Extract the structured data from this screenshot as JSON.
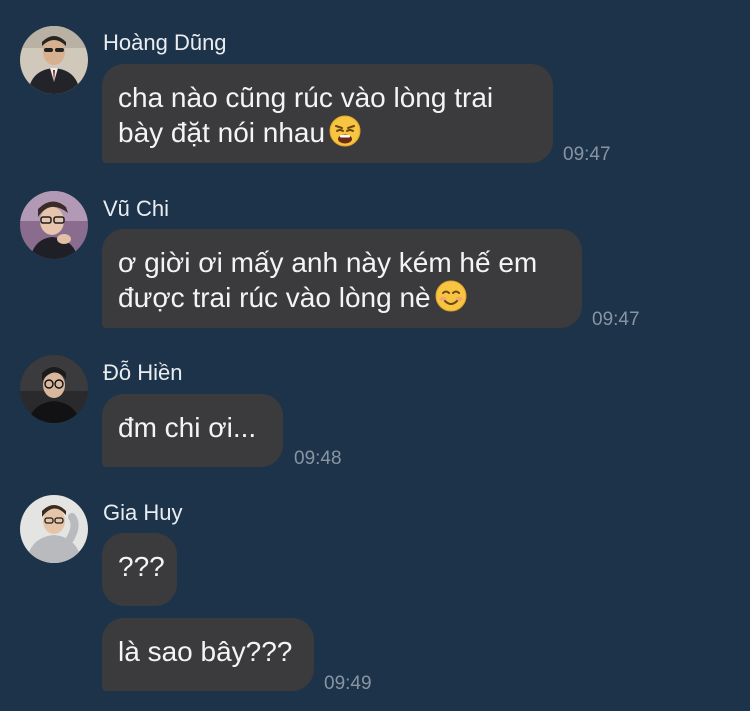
{
  "messages": [
    {
      "sender": "Hoàng Dũng",
      "avatar_icon": "profile-photo-man-suit",
      "line1": "cha nào cũng rúc vào lòng trai",
      "line2": "bày đặt nói nhau",
      "emoji": "weary-face-emoji",
      "time": "09:47"
    },
    {
      "sender": "Vũ Chi",
      "avatar_icon": "profile-photo-man-glasses",
      "line1": "ơ giời ơi mấy anh này kém hế em",
      "line2": "được trai rúc vào lòng nè",
      "emoji": "smiling-face-emoji",
      "time": "09:47"
    },
    {
      "sender": "Đỗ Hiền",
      "avatar_icon": "profile-photo-man-dark",
      "text": "đm chi ơi...",
      "time": "09:48"
    },
    {
      "sender": "Gia Huy",
      "avatar_icon": "profile-photo-man-hoodie",
      "text": "???",
      "text2": "là sao bây???",
      "time": "09:49"
    }
  ],
  "colors": {
    "background": "#1d3349",
    "bubble": "#3b3b3d",
    "text": "#f4f4f4",
    "timestamp": "#8795a3"
  }
}
